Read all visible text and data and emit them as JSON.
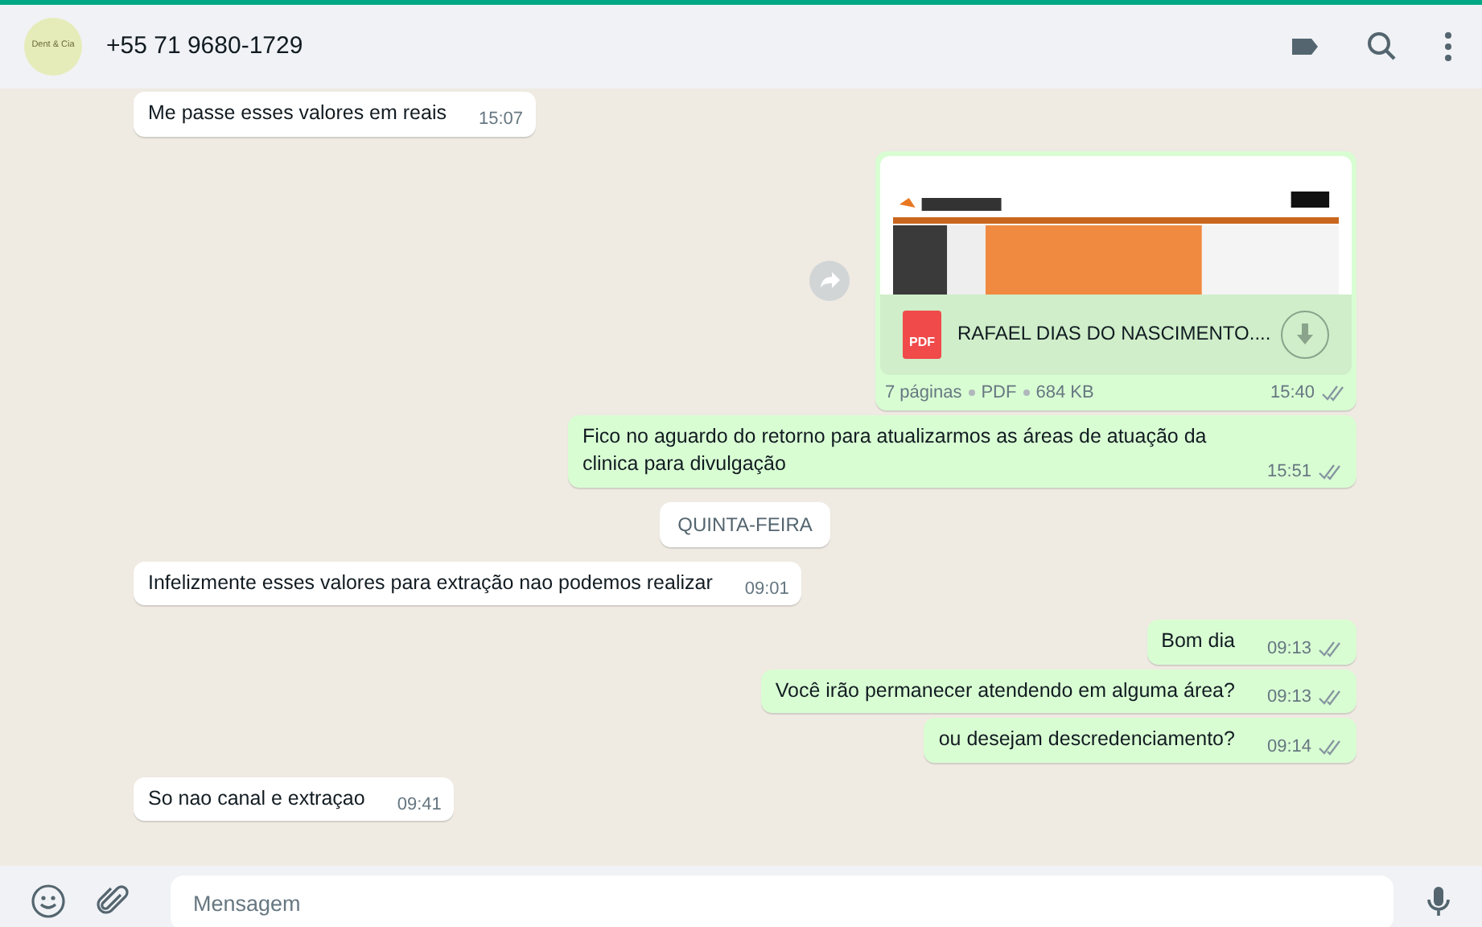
{
  "header": {
    "avatar_text": "Dent & Cia",
    "title": "+55 71 9680-1729"
  },
  "messages": [
    {
      "kind": "text",
      "outgoing": false,
      "text": "Me passe esses valores em reais",
      "time": "15:07"
    },
    {
      "kind": "document",
      "outgoing": true,
      "file_name": "RAFAEL DIAS DO NASCIMENTO....",
      "pages": "7 páginas",
      "file_type": "PDF",
      "size": "684 KB",
      "icon_label": "PDF",
      "time": "15:40",
      "read": false
    },
    {
      "kind": "text",
      "outgoing": true,
      "text": "Fico no aguardo do retorno para atualizarmos as áreas de atuação da clinica para divulgação",
      "time": "15:51",
      "read": false
    },
    {
      "kind": "day",
      "text": "QUINTA-FEIRA"
    },
    {
      "kind": "text",
      "outgoing": false,
      "text": "Infelizmente esses valores para extração nao podemos realizar",
      "time": "09:01"
    },
    {
      "kind": "text",
      "outgoing": true,
      "text": "Bom dia",
      "time": "09:13",
      "read": false
    },
    {
      "kind": "text",
      "outgoing": true,
      "text": "Você irão permanecer atendendo em alguma área?",
      "time": "09:13",
      "read": false
    },
    {
      "kind": "text",
      "outgoing": true,
      "text": "ou desejam descredenciamento?",
      "time": "09:14",
      "read": false
    },
    {
      "kind": "text",
      "outgoing": false,
      "text": "So nao canal e extraçao",
      "time": "09:41"
    }
  ],
  "composer": {
    "placeholder": "Mensagem"
  }
}
